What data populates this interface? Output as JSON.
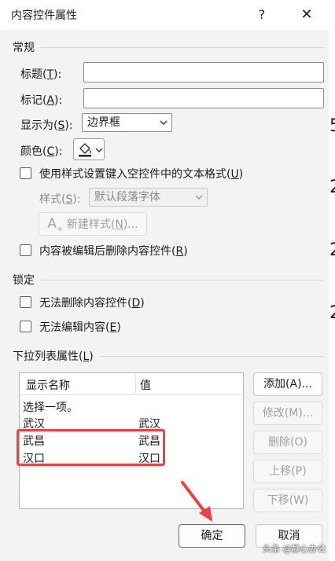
{
  "window": {
    "title": "内容控件属性",
    "help": "?",
    "close": "✕"
  },
  "general": {
    "section": "常规",
    "title_label": "标题(",
    "title_key": "T",
    "title_end": "):",
    "title_value": "",
    "tag_label": "标记(",
    "tag_key": "A",
    "tag_end": "):",
    "tag_value": "",
    "show_as_label": "显示为(",
    "show_as_key": "S",
    "show_as_end": "):",
    "show_as_value": "边界框",
    "color_label": "颜色(",
    "color_key": "C",
    "color_end": "):",
    "use_style_label": "使用样式设置键入空控件中的文本格式(",
    "use_style_key": "U",
    "use_style_end": ")",
    "use_style_checked": false,
    "style_label": "样式(",
    "style_key": "S",
    "style_end": "):",
    "style_value": "默认段落字体",
    "new_style_label": "新建样式(",
    "new_style_key": "N",
    "new_style_end": ")...",
    "remove_label": "内容被编辑后删除内容控件(",
    "remove_key": "R",
    "remove_end": ")",
    "remove_checked": false
  },
  "lock": {
    "section": "锁定",
    "no_delete_label": "无法删除内容控件(",
    "no_delete_key": "D",
    "no_delete_end": ")",
    "no_delete_checked": false,
    "no_edit_label": "无法编辑内容(",
    "no_edit_key": "E",
    "no_edit_end": ")",
    "no_edit_checked": false
  },
  "dropdown": {
    "section_label": "下拉列表属性(",
    "section_key": "L",
    "section_end": ")",
    "col_display": "显示名称",
    "col_value": "值",
    "items": [
      {
        "display": "选择一项。",
        "value": ""
      },
      {
        "display": "武汉",
        "value": "武汉"
      },
      {
        "display": "武昌",
        "value": "武昌"
      },
      {
        "display": "汉口",
        "value": "汉口"
      }
    ],
    "add": "添加(A)...",
    "modify": "修改(M)...",
    "delete": "删除(O)",
    "move_up": "上移(P)",
    "move_down": "下移(W)"
  },
  "footer": {
    "ok": "确定",
    "cancel": "取消"
  },
  "background": {
    "side_glyphs": [
      "5",
      "2",
      "2",
      "2"
    ]
  },
  "watermark": "头条 @静心办公",
  "colors": {
    "annotation": "#e84444",
    "dialog_bg": "#f3f3f3"
  }
}
